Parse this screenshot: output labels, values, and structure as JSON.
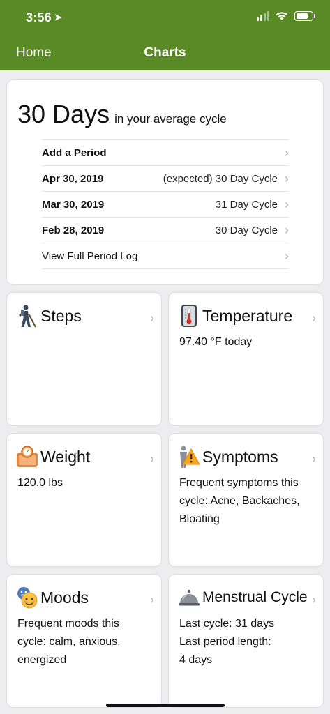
{
  "status_bar": {
    "time": "3:56"
  },
  "nav": {
    "back_label": "Home",
    "title": "Charts"
  },
  "cycle": {
    "days": "30 Days",
    "subtitle": "in your average cycle",
    "rows": [
      {
        "left": "Add a Period",
        "right": ""
      },
      {
        "left": "Apr 30, 2019",
        "right": "(expected) 30 Day Cycle"
      },
      {
        "left": "Mar 30, 2019",
        "right": "31 Day Cycle"
      },
      {
        "left": "Feb 28, 2019",
        "right": "30 Day Cycle"
      },
      {
        "left": "View Full Period Log",
        "right": ""
      }
    ]
  },
  "tiles": {
    "steps": {
      "title": "Steps",
      "icon": "hiker-icon",
      "lines": []
    },
    "temperature": {
      "title": "Temperature",
      "icon": "thermometer-icon",
      "lines": [
        "97.40 °F today"
      ]
    },
    "weight": {
      "title": "Weight",
      "icon": "scale-icon",
      "lines": [
        "120.0 lbs"
      ]
    },
    "symptoms": {
      "title": "Symptoms",
      "icon": "person-warning-icon",
      "lines": [
        "Frequent symptoms this",
        "cycle: Acne, Backaches,",
        "Bloating"
      ]
    },
    "moods": {
      "title": "Moods",
      "icon": "faces-icon",
      "lines": [
        "Frequent moods this",
        "cycle: calm, anxious,",
        "energized"
      ]
    },
    "menstrual": {
      "title": "Menstrual Cycle",
      "icon": "cloche-icon",
      "lines": [
        "Last cycle: 31 days",
        "Last period length:",
        "4 days"
      ]
    }
  },
  "colors": {
    "header": "#5a8a26",
    "background": "#ededf0",
    "card": "#ffffff"
  }
}
